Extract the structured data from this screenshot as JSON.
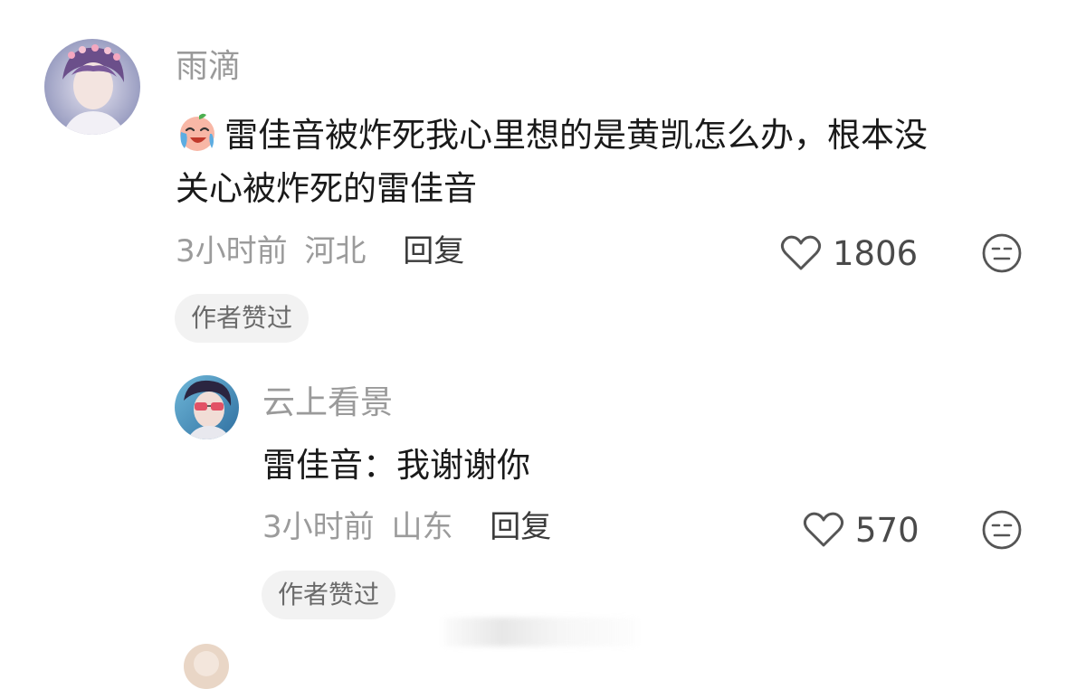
{
  "comments": [
    {
      "username": "雨滴",
      "emoji_icon": "crying-laughing-face-emoji",
      "text_line1": "雷佳音被炸死我心里想的是黄凯怎么办，根本没",
      "text_line2": "关心被炸死的雷佳音",
      "time": "3小时前",
      "location": "河北",
      "reply_label": "回复",
      "likes": "1806",
      "badge": "作者赞过"
    },
    {
      "username": "云上看景",
      "text": "雷佳音：我谢谢你",
      "time": "3小时前",
      "location": "山东",
      "reply_label": "回复",
      "likes": "570",
      "badge": "作者赞过"
    }
  ],
  "colors": {
    "username": "#9a9a9a",
    "text": "#1a1a1a",
    "meta": "#9b9b9b",
    "badge_bg": "#f2f2f2"
  }
}
